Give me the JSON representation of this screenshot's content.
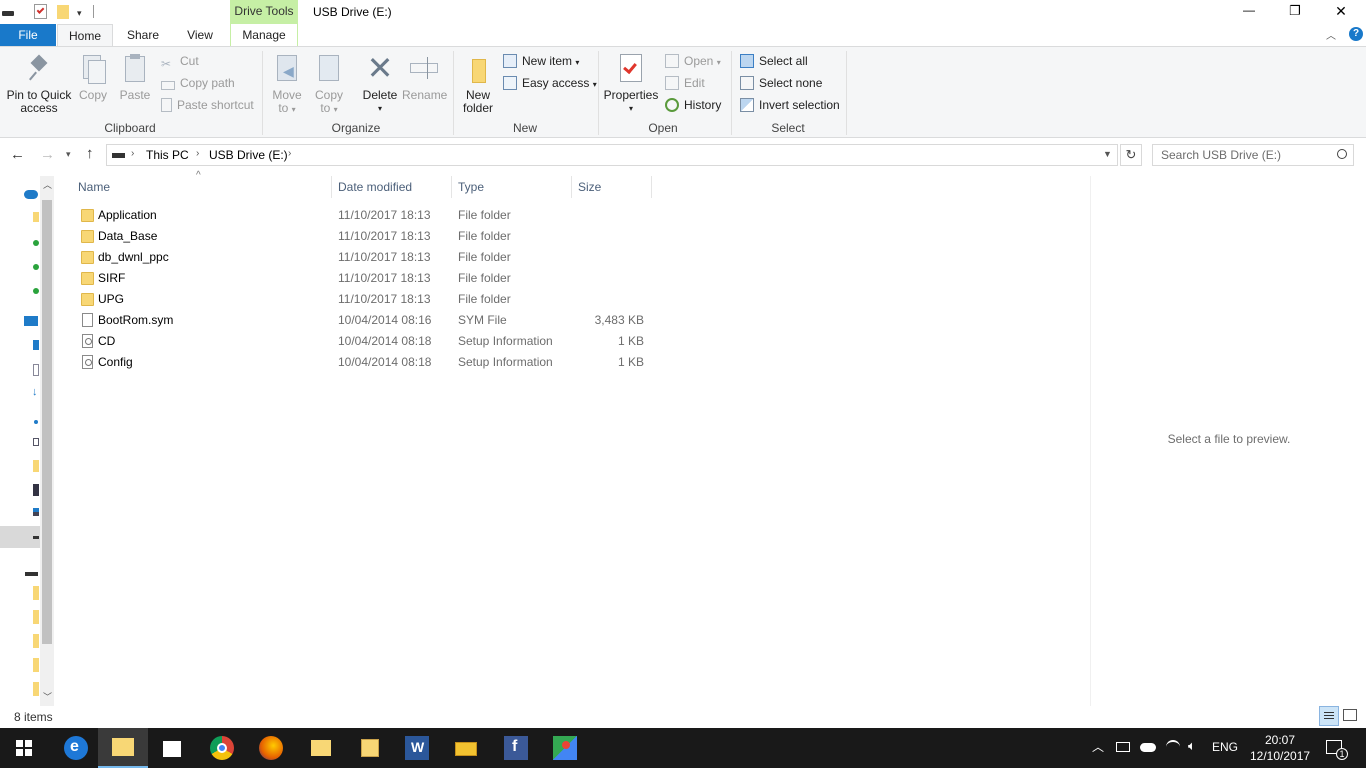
{
  "window": {
    "title": "USB Drive (E:)",
    "contextual_tab": "Drive Tools",
    "controls": {
      "minimize": "—",
      "maximize": "❐",
      "close": "✕"
    }
  },
  "ribbon": {
    "tabs": [
      "File",
      "Home",
      "Share",
      "View",
      "Manage"
    ],
    "clipboard": {
      "pin_label": "Pin to Quick access",
      "pin_l1": "Pin to Quick",
      "pin_l2": "access",
      "copy": "Copy",
      "paste": "Paste",
      "cut": "Cut",
      "copy_path": "Copy path",
      "paste_shortcut": "Paste shortcut",
      "group": "Clipboard"
    },
    "organize": {
      "move_l1": "Move",
      "move_l2": "to",
      "copy_l1": "Copy",
      "copy_l2": "to",
      "delete": "Delete",
      "rename": "Rename",
      "group": "Organize"
    },
    "new": {
      "folder_l1": "New",
      "folder_l2": "folder",
      "new_item": "New item",
      "easy_access": "Easy access",
      "group": "New"
    },
    "open": {
      "properties": "Properties",
      "open": "Open",
      "edit": "Edit",
      "history": "History",
      "group": "Open"
    },
    "select": {
      "select_all": "Select all",
      "select_none": "Select none",
      "invert": "Invert selection",
      "group": "Select"
    }
  },
  "address": {
    "crumbs": [
      "This PC",
      "USB Drive (E:)"
    ],
    "search_placeholder": "Search USB Drive (E:)"
  },
  "columns": [
    "Name",
    "Date modified",
    "Type",
    "Size"
  ],
  "files": [
    {
      "name": "Application",
      "date": "11/10/2017 18:13",
      "type": "File folder",
      "size": "",
      "kind": "folder"
    },
    {
      "name": "Data_Base",
      "date": "11/10/2017 18:13",
      "type": "File folder",
      "size": "",
      "kind": "folder"
    },
    {
      "name": "db_dwnl_ppc",
      "date": "11/10/2017 18:13",
      "type": "File folder",
      "size": "",
      "kind": "folder"
    },
    {
      "name": "SIRF",
      "date": "11/10/2017 18:13",
      "type": "File folder",
      "size": "",
      "kind": "folder"
    },
    {
      "name": "UPG",
      "date": "11/10/2017 18:13",
      "type": "File folder",
      "size": "",
      "kind": "folder"
    },
    {
      "name": "BootRom.sym",
      "date": "10/04/2014 08:16",
      "type": "SYM File",
      "size": "3,483 KB",
      "kind": "file"
    },
    {
      "name": "CD",
      "date": "10/04/2014 08:18",
      "type": "Setup Information",
      "size": "1 KB",
      "kind": "setup"
    },
    {
      "name": "Config",
      "date": "10/04/2014 08:18",
      "type": "Setup Information",
      "size": "1 KB",
      "kind": "setup"
    }
  ],
  "preview_text": "Select a file to preview.",
  "status": {
    "item_count": "8 items"
  },
  "taskbar": {
    "language": "ENG",
    "time": "20:07",
    "date": "12/10/2017",
    "notification_count": "1"
  },
  "colors": {
    "file_tab": "#1979ca",
    "drive_tools": "#c6efa5",
    "taskbar": "#191919"
  }
}
